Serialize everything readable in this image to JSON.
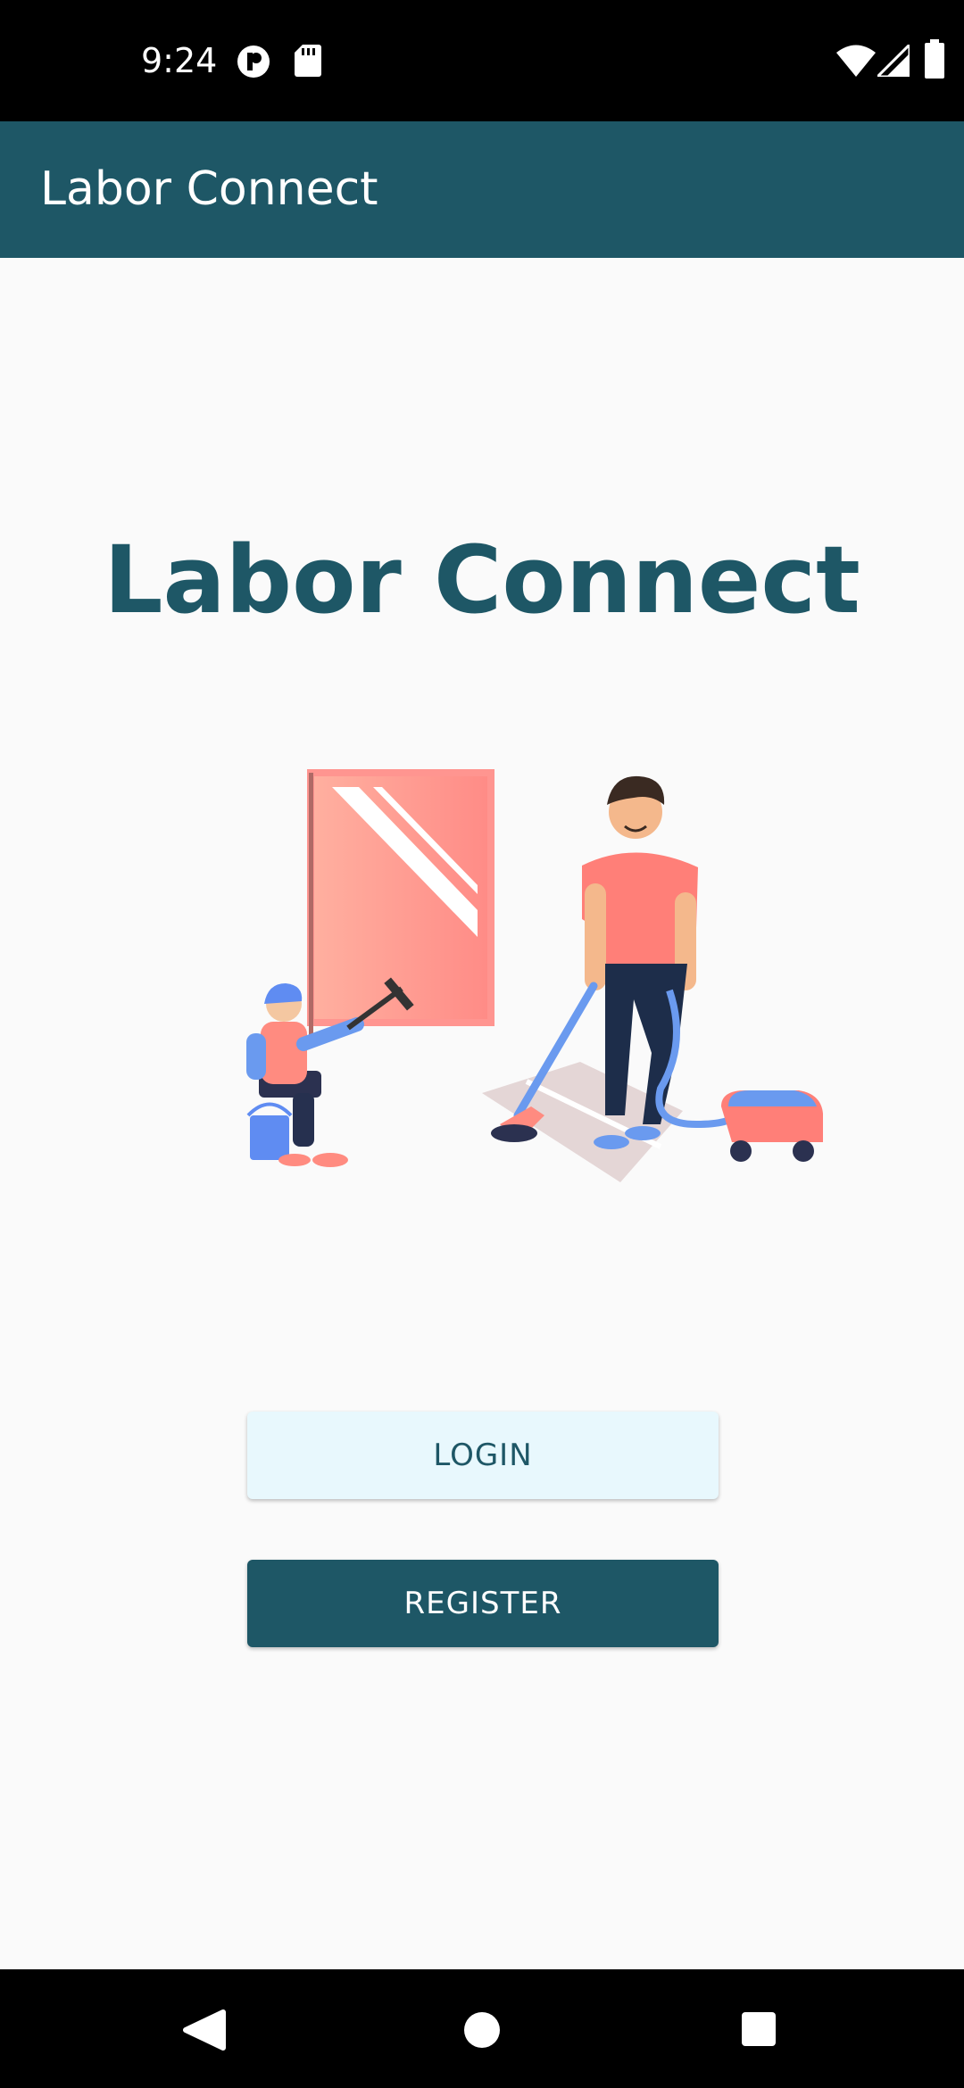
{
  "status_bar": {
    "time": "9:24",
    "icons": [
      "data-saver-icon",
      "sd-card-icon",
      "wifi-icon",
      "signal-icon",
      "battery-icon"
    ]
  },
  "app_bar": {
    "title": "Labor Connect"
  },
  "main": {
    "title": "Labor Connect",
    "illustration": "workers-cleaning-illustration",
    "login_label": "LOGIN",
    "register_label": "REGISTER"
  },
  "nav_bar": {
    "icons": [
      "back-icon",
      "home-icon",
      "recents-icon"
    ]
  },
  "colors": {
    "primary": "#1e5766",
    "login_bg": "#e8f8fd",
    "background": "#fafafa"
  }
}
